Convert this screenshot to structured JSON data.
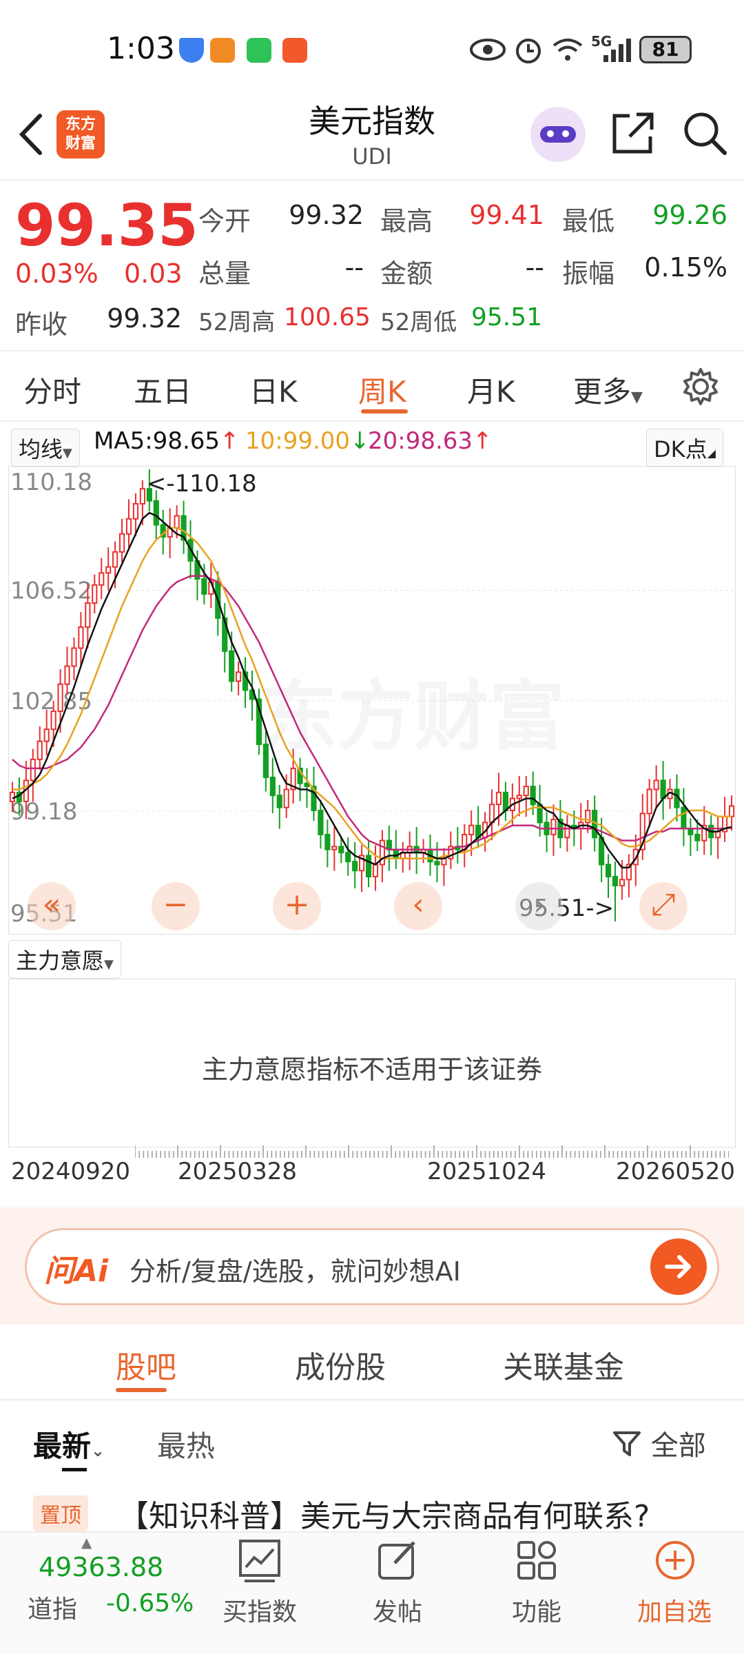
{
  "status": {
    "time": "1:03",
    "battery": "81",
    "network": "5G"
  },
  "header": {
    "title": "美元指数",
    "subtitle": "UDI",
    "logo_line1": "东方",
    "logo_line2": "财富"
  },
  "quote": {
    "price": "99.35",
    "change_pct": "0.03%",
    "change": "0.03",
    "open_label": "今开",
    "open": "99.32",
    "high_label": "最高",
    "high": "99.41",
    "low_label": "最低",
    "low": "99.26",
    "volume_label": "总量",
    "volume": "--",
    "amount_label": "金额",
    "amount": "--",
    "amplitude_label": "振幅",
    "amplitude": "0.15%",
    "prev_close_label": "昨收",
    "prev_close": "99.32",
    "w52_high_label": "52周高",
    "w52_high": "100.65",
    "w52_low_label": "52周低",
    "w52_low": "95.51"
  },
  "period_tabs": [
    "分时",
    "五日",
    "日K",
    "周K",
    "月K",
    "更多"
  ],
  "active_period": "周K",
  "ma": {
    "selector": "均线",
    "ma5": "MA5:98.65",
    "ma10": "10:99.00",
    "ma20": "20:98.63",
    "dk": "DK点"
  },
  "colors": {
    "up": "#e8302f",
    "down": "#12a022",
    "accent": "#e8672f",
    "ma5": "#111111",
    "ma10": "#e8a21f",
    "ma20": "#c2287a"
  },
  "chart_data": {
    "type": "candlestick",
    "y_ticks": [
      "110.18",
      "106.52",
      "102.85",
      "99.18",
      "95.51"
    ],
    "ylim": [
      95.51,
      110.18
    ],
    "max_label": "<-110.18",
    "min_label": "95.51->",
    "x_ticks": [
      "20240920",
      "20250328",
      "20251024",
      "20260520"
    ],
    "closes": [
      99.8,
      99.5,
      100.2,
      100.9,
      101.5,
      101.9,
      102.5,
      103.4,
      104.0,
      104.6,
      105.3,
      106.1,
      106.7,
      107.1,
      107.3,
      107.8,
      108.4,
      108.9,
      109.4,
      109.9,
      109.5,
      108.7,
      108.3,
      108.6,
      109.0,
      108.2,
      107.5,
      106.9,
      106.4,
      106.8,
      105.6,
      104.5,
      103.5,
      103.8,
      103.2,
      102.9,
      101.4,
      100.3,
      99.7,
      99.3,
      99.9,
      100.6,
      100.1,
      100.0,
      99.2,
      98.4,
      97.9,
      98.0,
      97.8,
      97.5,
      97.2,
      97.7,
      97.0,
      97.4,
      98.2,
      97.9,
      97.6,
      97.8,
      98.0,
      97.8,
      97.9,
      97.5,
      97.4,
      97.6,
      98.0,
      97.9,
      98.4,
      98.7,
      98.3,
      98.8,
      99.4,
      99.8,
      99.2,
      99.6,
      99.7,
      100.0,
      99.4,
      98.8,
      98.4,
      98.9,
      98.3,
      98.7,
      98.6,
      98.8,
      99.2,
      98.3,
      97.4,
      97.0,
      96.7,
      96.9,
      97.4,
      97.9,
      99.1,
      99.9,
      100.2,
      99.6,
      99.9,
      99.3,
      98.6,
      98.4,
      98.2,
      98.7,
      98.3,
      98.5,
      99.0,
      99.35
    ],
    "ma5": [
      99.6,
      99.7,
      99.9,
      100.1,
      100.4,
      100.9,
      101.5,
      102.1,
      102.7,
      103.3,
      104.0,
      104.7,
      105.3,
      105.9,
      106.4,
      106.9,
      107.4,
      107.9,
      108.4,
      108.9,
      109.1,
      109.0,
      108.8,
      108.6,
      108.4,
      108.3,
      107.9,
      107.5,
      107.1,
      106.8,
      106.2,
      105.5,
      104.8,
      104.3,
      103.7,
      103.3,
      102.6,
      101.9,
      101.2,
      100.5,
      100.1,
      100.0,
      99.9,
      99.9,
      99.8,
      99.5,
      99.1,
      98.7,
      98.3,
      97.9,
      97.7,
      97.6,
      97.5,
      97.4,
      97.6,
      97.7,
      97.7,
      97.8,
      97.8,
      97.8,
      97.8,
      97.7,
      97.6,
      97.6,
      97.7,
      97.8,
      97.9,
      98.1,
      98.3,
      98.5,
      98.8,
      99.0,
      99.2,
      99.4,
      99.5,
      99.6,
      99.6,
      99.4,
      99.2,
      99.1,
      98.8,
      98.7,
      98.6,
      98.7,
      98.7,
      98.6,
      98.3,
      97.9,
      97.6,
      97.3,
      97.3,
      97.6,
      98.1,
      98.7,
      99.3,
      99.6,
      99.8,
      99.7,
      99.4,
      99.1,
      98.8,
      98.6,
      98.5,
      98.5,
      98.6,
      98.65
    ],
    "ma10": [
      99.9,
      99.9,
      100.0,
      100.1,
      100.2,
      100.4,
      100.7,
      101.0,
      101.4,
      101.9,
      102.4,
      103.0,
      103.6,
      104.2,
      104.8,
      105.4,
      106.0,
      106.5,
      107.0,
      107.5,
      107.9,
      108.2,
      108.4,
      108.6,
      108.6,
      108.5,
      108.3,
      108.1,
      107.8,
      107.5,
      107.0,
      106.5,
      105.9,
      105.3,
      104.7,
      104.2,
      103.6,
      103.0,
      102.4,
      101.8,
      101.3,
      100.9,
      100.5,
      100.2,
      99.9,
      99.7,
      99.5,
      99.3,
      99.0,
      98.7,
      98.4,
      98.1,
      97.9,
      97.7,
      97.6,
      97.6,
      97.6,
      97.6,
      97.6,
      97.6,
      97.6,
      97.6,
      97.6,
      97.7,
      97.7,
      97.8,
      97.8,
      97.9,
      98.0,
      98.1,
      98.3,
      98.5,
      98.7,
      98.9,
      99.1,
      99.2,
      99.3,
      99.3,
      99.3,
      99.3,
      99.2,
      99.1,
      99.0,
      98.9,
      98.9,
      98.8,
      98.7,
      98.5,
      98.3,
      98.1,
      98.0,
      98.0,
      98.1,
      98.2,
      98.4,
      98.6,
      98.8,
      99.0,
      99.1,
      99.2,
      99.2,
      99.2,
      99.1,
      99.0,
      99.0,
      99.0
    ],
    "ma20": [
      100.9,
      100.7,
      100.6,
      100.6,
      100.6,
      100.6,
      100.7,
      100.8,
      100.9,
      101.1,
      101.3,
      101.6,
      101.9,
      102.3,
      102.7,
      103.2,
      103.7,
      104.2,
      104.7,
      105.2,
      105.6,
      106.0,
      106.3,
      106.6,
      106.8,
      106.9,
      107.0,
      107.0,
      107.0,
      106.9,
      106.8,
      106.6,
      106.3,
      106.0,
      105.6,
      105.2,
      104.8,
      104.3,
      103.8,
      103.3,
      102.8,
      102.3,
      101.8,
      101.4,
      101.0,
      100.6,
      100.2,
      99.8,
      99.4,
      99.0,
      98.7,
      98.4,
      98.2,
      98.1,
      98.0,
      97.9,
      97.9,
      97.9,
      97.9,
      97.9,
      97.9,
      97.9,
      97.9,
      97.9,
      97.9,
      98.0,
      98.0,
      98.1,
      98.2,
      98.3,
      98.4,
      98.5,
      98.6,
      98.7,
      98.7,
      98.7,
      98.7,
      98.6,
      98.6,
      98.6,
      98.6,
      98.6,
      98.6,
      98.6,
      98.6,
      98.6,
      98.5,
      98.4,
      98.3,
      98.2,
      98.2,
      98.2,
      98.3,
      98.4,
      98.5,
      98.5,
      98.6,
      98.6,
      98.6,
      98.6,
      98.6,
      98.6,
      98.6,
      98.6,
      98.6,
      98.63
    ]
  },
  "intent": {
    "selector": "主力意愿",
    "message": "主力意愿指标不适用于该证券"
  },
  "ai": {
    "logo": "问Ai",
    "placeholder": "分析/复盘/选股，就问妙想AI"
  },
  "section_tabs": [
    "股吧",
    "成份股",
    "关联基金"
  ],
  "active_section": "股吧",
  "feed_tabs": [
    "最新",
    "最热"
  ],
  "filter_label": "全部",
  "pinned": {
    "badge": "置顶",
    "title": "【知识科普】美元与大宗商品有何联系?"
  },
  "nav": {
    "dow_value": "49363.88",
    "dow_label": "道指",
    "dow_change": "-0.65%",
    "items": [
      "买指数",
      "发帖",
      "功能",
      "加自选"
    ]
  }
}
